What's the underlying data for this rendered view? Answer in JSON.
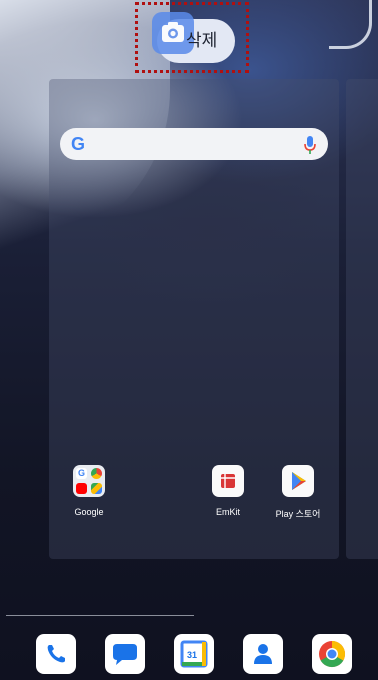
{
  "drop_target": {
    "label": "삭제"
  },
  "search": {
    "logo": "G"
  },
  "apps": [
    {
      "label": "Google"
    },
    {
      "label": "EmKit"
    },
    {
      "label": "Play 스토어"
    }
  ],
  "dock": [
    "phone-icon",
    "messages-icon",
    "calendar-icon",
    "contacts-icon",
    "chrome-icon"
  ],
  "calendar": {
    "day": "31"
  },
  "colors": {
    "accent": "#4285f4",
    "highlight_border": "#b01010"
  }
}
